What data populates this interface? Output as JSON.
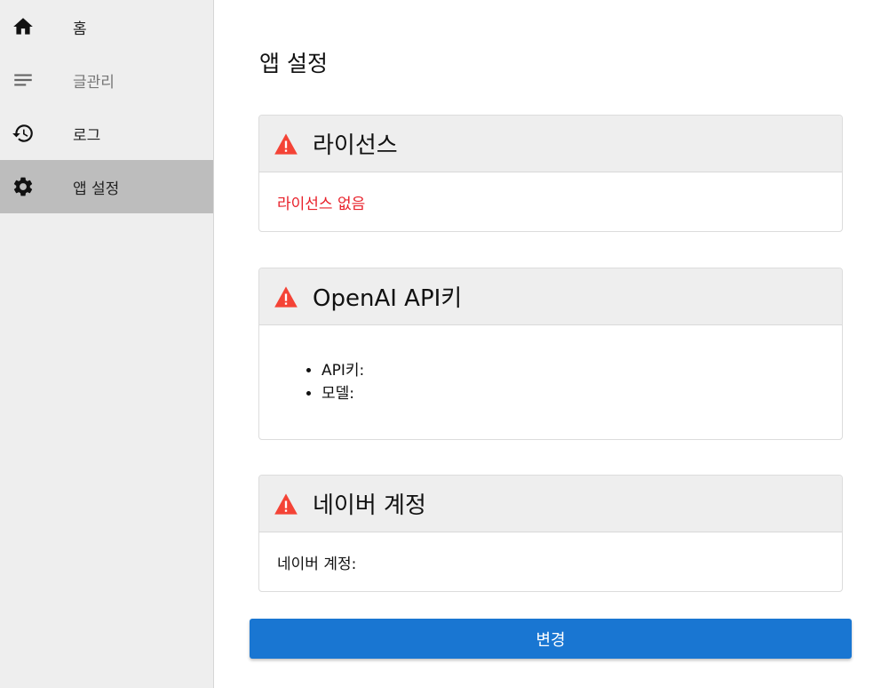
{
  "sidebar": {
    "items": [
      {
        "label": "홈",
        "icon": "home-icon"
      },
      {
        "label": "글관리",
        "icon": "notes-icon"
      },
      {
        "label": "로그",
        "icon": "history-icon"
      },
      {
        "label": "앱 설정",
        "icon": "gear-icon",
        "active": true
      }
    ]
  },
  "main": {
    "title": "앱 설정",
    "license": {
      "title": "라이선스",
      "status": "라이선스 없음"
    },
    "openai": {
      "title": "OpenAI API키",
      "items": [
        "API키:",
        "모델:"
      ]
    },
    "naver": {
      "title": "네이버 계정",
      "account_label": "네이버 계정:"
    },
    "change_button": "변경"
  },
  "colors": {
    "accent": "#1976d2",
    "warning": "#f44336",
    "error_text": "#e8202a",
    "sidebar_bg": "#eeeeee",
    "sidebar_active": "#bdbdbd"
  }
}
